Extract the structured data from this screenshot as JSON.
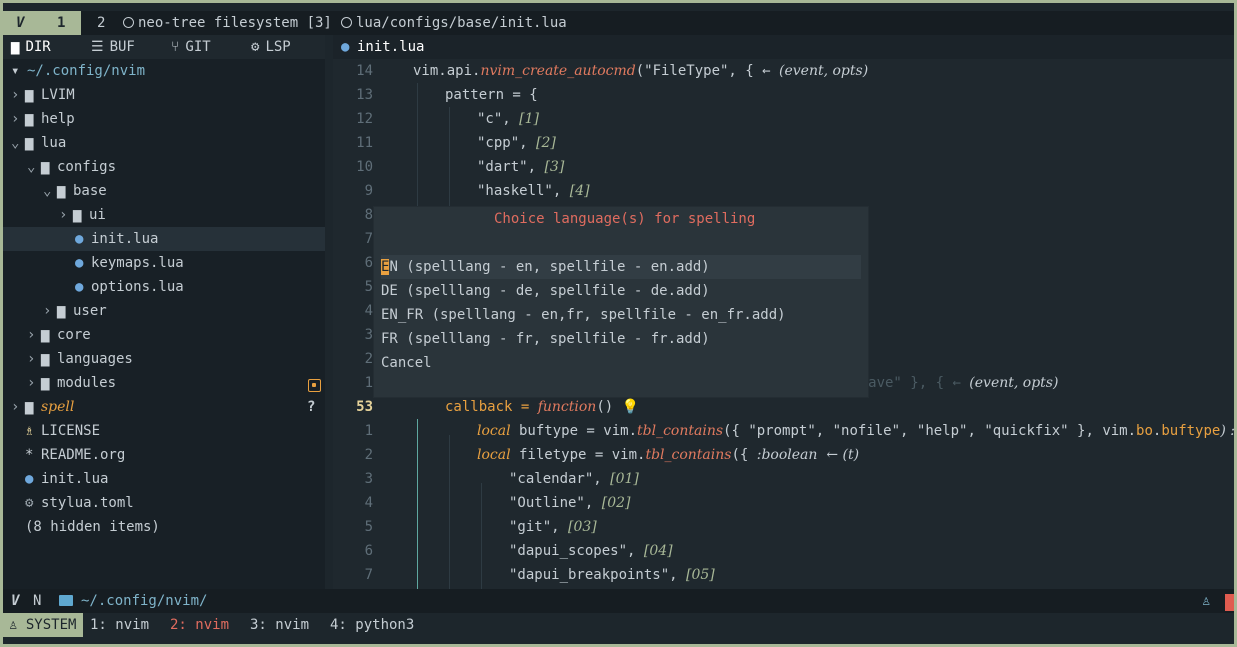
{
  "tabline": {
    "vim_mark": "V",
    "tab1": "1",
    "tab2_num": "2",
    "tab2_label": "neo-tree filesystem [3]",
    "tab3_label": "lua/configs/base/init.lua"
  },
  "sidebar": {
    "tabs": [
      {
        "label": "DIR",
        "icon": "folder-icon"
      },
      {
        "label": "BUF",
        "icon": "list-icon"
      },
      {
        "label": "GIT",
        "icon": "git-branch-icon"
      },
      {
        "label": "LSP",
        "icon": "gears-icon"
      }
    ],
    "root": "~/.config/nvim",
    "items": [
      {
        "label": "LVIM"
      },
      {
        "label": "help"
      },
      {
        "label": "lua"
      },
      {
        "label": "configs"
      },
      {
        "label": "base"
      },
      {
        "label": "ui"
      },
      {
        "label": "init.lua"
      },
      {
        "label": "keymaps.lua"
      },
      {
        "label": "options.lua"
      },
      {
        "label": "user"
      },
      {
        "label": "core"
      },
      {
        "label": "languages"
      },
      {
        "label": "modules"
      },
      {
        "label": "spell",
        "badge": "?"
      },
      {
        "label": "LICENSE"
      },
      {
        "label": "README.org"
      },
      {
        "label": "init.lua"
      },
      {
        "label": "stylua.toml"
      }
    ],
    "hidden": "(8 hidden items)"
  },
  "editor": {
    "filename": "init.lua",
    "gutter": [
      "14",
      "13",
      "12",
      "11",
      "10",
      "9",
      "8",
      "7",
      "6",
      "5",
      "4",
      "3",
      "2",
      "1",
      "53",
      "1",
      "2",
      "3",
      "4",
      "5",
      "6",
      "7"
    ],
    "lines": {
      "l14_a": "vim",
      "l14_b": ".api.",
      "l14_fn": "nvim_create_autocmd",
      "l14_c": "(\"FileType\", { ← ",
      "l14_hint": "(event, opts)",
      "l13": "pattern = {",
      "l12_s": "\"c\",",
      "l12_i": "[1]",
      "l11_s": "\"cpp\",",
      "l11_i": "[2]",
      "l10_s": "\"dart\",",
      "l10_i": "[3]",
      "l9_s": "\"haskell\",",
      "l9_i": "[4]",
      "l1_a": "vim.api.nvim_create_autocmd({ \"BufWinEnter\", \"BufWinLeave\" }, { ← ",
      "l1_hint": "(event, opts)",
      "l53_a": "callback = ",
      "l53_fn": "function",
      "l53_b": "() ",
      "r1_kw": "local",
      "r1_a": " buftype = vim.",
      "r1_fn": "tbl_contains",
      "r1_b": "({ \"prompt\", \"nofile\", \"help\", \"quickfix\" }, vim.",
      "r1_c": "bo",
      "r1_d": ".",
      "r1_e": "buftype",
      "r1_f": ") :b",
      "r2_kw": "local",
      "r2_a": " filetype = vim.",
      "r2_fn": "tbl_contains",
      "r2_b": "({ ",
      "r2_hint": ":boolean  ← (t)",
      "r3_s": "\"calendar\",",
      "r3_i": "[01]",
      "r4_s": "\"Outline\",",
      "r4_i": "[02]",
      "r5_s": "\"git\",",
      "r5_i": "[03]",
      "r6_s": "\"dapui_scopes\",",
      "r6_i": "[04]",
      "r7_s": "\"dapui_breakpoints\",",
      "r7_i": "[05]"
    }
  },
  "popup": {
    "title": "Choice language(s) for spelling",
    "options": [
      {
        "cursor": "E",
        "rest": "N (spelllang - en, spellfile - en.add)"
      },
      {
        "label": "DE (spelllang - de, spellfile - de.add)"
      },
      {
        "label": "EN_FR (spelllang - en,fr, spellfile - en_fr.add)"
      },
      {
        "label": "FR (spelllang - fr, spellfile - fr.add)"
      },
      {
        "label": "Cancel"
      }
    ]
  },
  "statusline": {
    "vim_mark": "V",
    "mode": "N",
    "path": "~/.config/nvim/"
  },
  "tmux": {
    "session": "SYSTEM",
    "windows": [
      {
        "label": "1: nvim"
      },
      {
        "label": "2: nvim",
        "active": true
      },
      {
        "label": "3: nvim"
      },
      {
        "label": "4: python3"
      }
    ]
  },
  "colors": {
    "background": "#1d262c",
    "accent_green": "#a8b897",
    "accent_orange": "#e8a040",
    "accent_red": "#e06c5f",
    "dir_blue": "#7fb4ca"
  }
}
